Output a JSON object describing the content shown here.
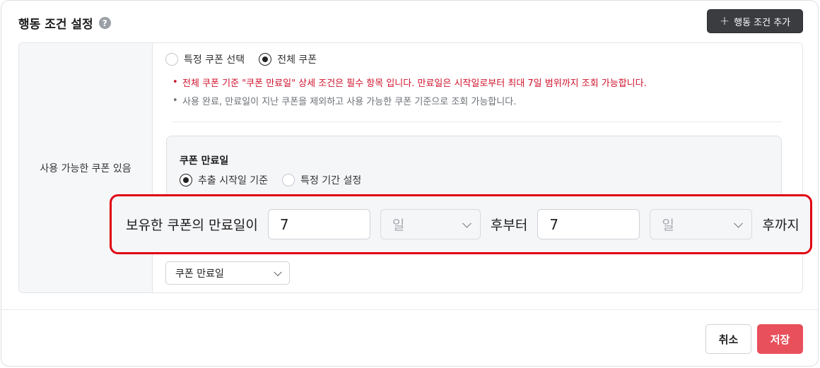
{
  "header": {
    "title": "행동 조건 설정",
    "help_icon": "?",
    "add_button_label": "행동 조건 추가",
    "add_button_icon": "+"
  },
  "row": {
    "label": "사용 가능한 쿠폰 있음",
    "coupon_scope": {
      "options": [
        "특정 쿠폰 선택",
        "전체 쿠폰"
      ],
      "selected": "전체 쿠폰"
    },
    "notes": [
      "전체 쿠폰 기준 \"쿠폰 만료일\" 상세 조건은 필수 항목 입니다. 만료일은 시작일로부터 최대 7일 범위까지 조회 가능합니다.",
      "사용 완료, 만료일이 지난 쿠폰을 제외하고 사용 가능한 쿠폰 기준으로 조회 가능합니다."
    ],
    "expiry_box": {
      "title": "쿠폰 만료일",
      "options": [
        "추출 시작일 기준",
        "특정 기간 설정"
      ],
      "selected": "추출 시작일 기준"
    },
    "condition": {
      "prefix": "보유한 쿠폰의 만료일이",
      "from_value": "7",
      "from_unit": "일",
      "middle": "후부터",
      "to_value": "7",
      "to_unit": "일",
      "suffix": "후까지"
    },
    "sort_select": "쿠폰 만료일"
  },
  "footer": {
    "cancel_label": "취소",
    "save_label": "저장"
  },
  "colors": {
    "accent": "#e8505b",
    "highlight_border": "#e00012",
    "notice_red": "#d0112b"
  }
}
